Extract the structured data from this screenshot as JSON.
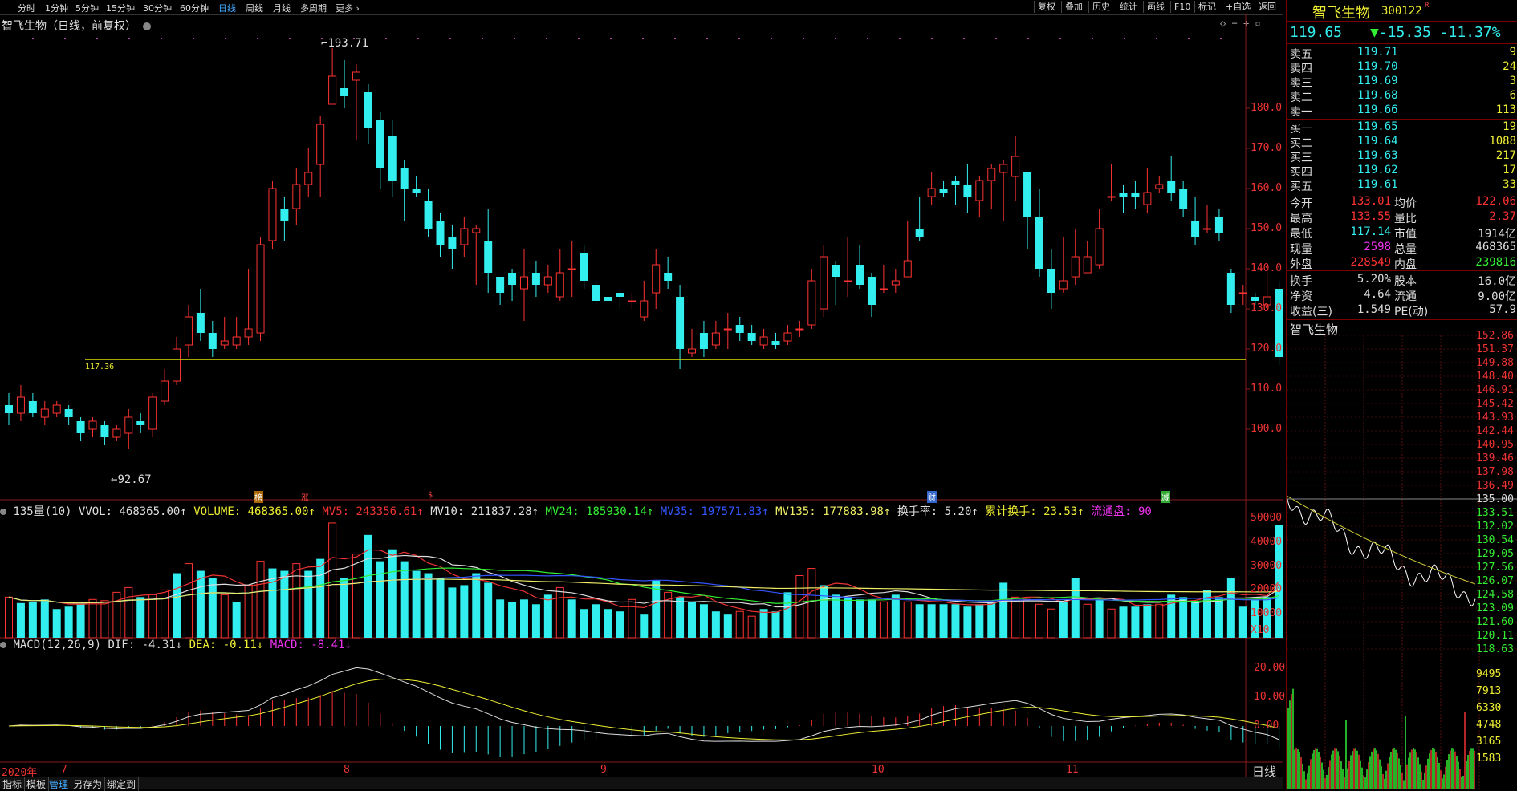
{
  "toolbar": {
    "periods": [
      {
        "label": "分时",
        "active": false
      },
      {
        "label": "1分钟",
        "active": false
      },
      {
        "label": "5分钟",
        "active": false
      },
      {
        "label": "15分钟",
        "active": false
      },
      {
        "label": "30分钟",
        "active": false
      },
      {
        "label": "60分钟",
        "active": false
      },
      {
        "label": "日线",
        "active": true
      },
      {
        "label": "周线",
        "active": false
      },
      {
        "label": "月线",
        "active": false
      },
      {
        "label": "多周期",
        "active": false
      },
      {
        "label": "更多",
        "active": false
      }
    ],
    "tools": [
      "复权",
      "叠加",
      "历史",
      "统计",
      "画线",
      "F10",
      "标记",
      "+自选",
      "返回"
    ]
  },
  "chart_title": "智飞生物（日线，前复权）",
  "annotations": {
    "high": "193.71",
    "low": "92.67",
    "support": "117.36"
  },
  "event_tags": [
    "榜",
    "涨",
    "$",
    "财",
    "减"
  ],
  "volume_header": {
    "name": "135量(10)",
    "items": [
      {
        "text": "VVOL: 468365.00↑",
        "color": "#dddddd"
      },
      {
        "text": "VOLUME: 468365.00↑",
        "color": "#eeee33"
      },
      {
        "text": "MV5: 243356.61↑",
        "color": "#ee3333"
      },
      {
        "text": "MV10: 211837.28↑",
        "color": "#dddddd"
      },
      {
        "text": "MV24: 185930.14↑",
        "color": "#33ee33"
      },
      {
        "text": "MV35: 197571.83↑",
        "color": "#3355ff"
      },
      {
        "text": "MV135: 177883.98↑",
        "color": "#eeee66"
      },
      {
        "text": "换手率: 5.20↑",
        "color": "#dddddd"
      },
      {
        "text": "累计换手: 23.53↑",
        "color": "#eeee33"
      },
      {
        "text": "流通盘: 90",
        "color": "#ee33ee"
      }
    ]
  },
  "macd_header": {
    "name": "MACD(12,26,9)",
    "items": [
      {
        "text": "DIF: -4.31↓",
        "color": "#dddddd"
      },
      {
        "text": "DEA: -0.11↓",
        "color": "#eeee33"
      },
      {
        "text": "MACD: -8.41↓",
        "color": "#ee33ee"
      }
    ]
  },
  "price_axis": [
    "180.0",
    "170.0",
    "160.0",
    "150.0",
    "140.0",
    "130.0",
    "120.0",
    "110.0",
    "100.0"
  ],
  "volume_axis": [
    "50000",
    "40000",
    "30000",
    "20000",
    "10000",
    "X10"
  ],
  "macd_axis": [
    "20.00",
    "10.00",
    "0.00"
  ],
  "x_axis": {
    "year": "2020年",
    "months": [
      "7",
      "8",
      "9",
      "10",
      "11"
    ],
    "period_label": "日线"
  },
  "bottom_tabs": [
    "指标",
    "模板",
    "管理",
    "另存为",
    "绑定到"
  ],
  "colors": {
    "up": "#ff3333",
    "down": "#33eeee",
    "ma5": "#ee3333",
    "ma10": "#dddddd",
    "ma24": "#33ee33",
    "ma35": "#3355ff",
    "ma135": "#eeee66"
  },
  "chart_data": {
    "type": "candlestick",
    "ylim": [
      87,
      197
    ],
    "candles": [
      [
        106,
        104,
        109,
        101
      ],
      [
        104,
        108,
        111,
        102
      ],
      [
        107,
        104,
        109,
        103
      ],
      [
        103,
        105,
        107,
        101
      ],
      [
        104,
        106,
        107,
        103
      ],
      [
        105,
        103,
        106,
        101
      ],
      [
        102,
        99,
        103,
        97
      ],
      [
        100,
        102,
        103,
        98
      ],
      [
        101,
        98,
        102,
        96
      ],
      [
        98,
        100,
        101,
        97
      ],
      [
        99,
        103,
        105,
        95
      ],
      [
        102,
        101,
        104,
        99
      ],
      [
        100,
        108,
        109,
        98
      ],
      [
        107,
        112,
        115,
        106
      ],
      [
        112,
        120,
        123,
        111
      ],
      [
        121,
        128,
        131,
        118
      ],
      [
        129,
        124,
        135,
        122
      ],
      [
        124,
        120,
        127,
        118
      ],
      [
        121,
        122,
        128,
        120
      ],
      [
        121,
        123,
        128,
        120
      ],
      [
        123,
        125,
        140,
        121
      ],
      [
        124,
        146,
        148,
        122
      ],
      [
        147,
        160,
        162,
        145
      ],
      [
        155,
        152,
        158,
        147
      ],
      [
        155,
        161,
        165,
        151
      ],
      [
        161,
        164,
        170,
        158
      ],
      [
        166,
        176,
        178,
        158
      ],
      [
        181,
        188,
        195,
        181
      ],
      [
        185,
        183,
        192,
        180
      ],
      [
        187,
        189,
        191,
        172
      ],
      [
        184,
        175,
        186,
        171
      ],
      [
        177,
        165,
        179,
        160
      ],
      [
        173,
        162,
        177,
        158
      ],
      [
        165,
        160,
        167,
        152
      ],
      [
        160,
        159,
        163,
        158
      ],
      [
        157,
        150,
        160,
        148
      ],
      [
        152,
        146,
        154,
        143
      ],
      [
        148,
        145,
        151,
        140
      ],
      [
        146,
        150,
        153,
        143
      ],
      [
        149,
        150,
        151,
        136
      ],
      [
        147,
        139,
        155,
        134
      ],
      [
        138,
        134,
        137,
        131
      ],
      [
        139,
        136,
        140,
        132
      ],
      [
        135,
        138,
        145,
        127
      ],
      [
        139,
        136,
        142,
        133
      ],
      [
        136,
        138,
        141,
        134
      ],
      [
        133,
        139,
        145,
        132
      ],
      [
        140,
        140,
        147,
        133
      ],
      [
        144,
        137,
        146,
        135
      ],
      [
        136,
        132,
        137,
        131
      ],
      [
        133,
        132,
        135,
        130
      ],
      [
        134,
        133,
        135,
        130
      ],
      [
        132,
        132,
        134,
        130
      ],
      [
        128,
        132,
        137,
        127
      ],
      [
        134,
        141,
        145,
        130
      ],
      [
        139,
        137,
        143,
        135
      ],
      [
        133,
        120,
        136,
        115
      ],
      [
        119,
        120,
        125,
        118
      ],
      [
        124,
        120,
        127,
        118
      ],
      [
        121,
        124,
        127,
        120
      ],
      [
        125,
        125,
        129,
        120
      ],
      [
        126,
        124,
        128,
        122
      ],
      [
        124,
        122,
        126,
        121
      ],
      [
        121,
        123,
        125,
        120
      ],
      [
        122,
        121,
        124,
        120
      ],
      [
        122,
        124,
        126,
        121
      ],
      [
        125,
        125,
        127,
        123
      ],
      [
        126,
        137,
        140,
        125
      ],
      [
        130,
        143,
        146,
        128
      ],
      [
        141,
        138,
        142,
        131
      ],
      [
        137,
        137,
        148,
        133
      ],
      [
        141,
        136,
        146,
        135
      ],
      [
        138,
        131,
        139,
        128
      ],
      [
        135,
        135,
        141,
        134
      ],
      [
        136,
        137,
        140,
        134
      ],
      [
        138,
        142,
        152,
        138
      ],
      [
        150,
        148,
        158,
        147
      ],
      [
        158,
        160,
        164,
        156
      ],
      [
        160,
        159,
        162,
        158
      ],
      [
        162,
        161,
        163,
        156
      ],
      [
        161,
        158,
        166,
        154
      ],
      [
        157,
        162,
        163,
        153
      ],
      [
        162,
        165,
        166,
        155
      ],
      [
        164,
        166,
        167,
        152
      ],
      [
        163,
        168,
        173,
        157
      ],
      [
        164,
        153,
        164,
        145
      ],
      [
        153,
        140,
        160,
        138
      ],
      [
        140,
        134,
        145,
        130
      ],
      [
        135,
        137,
        148,
        134
      ],
      [
        138,
        143,
        150,
        136
      ],
      [
        139,
        143,
        147,
        142
      ],
      [
        141,
        150,
        155,
        140
      ],
      [
        158,
        158,
        166,
        157
      ],
      [
        159,
        158,
        161,
        154
      ],
      [
        159,
        158,
        162,
        155
      ],
      [
        156,
        159,
        165,
        154
      ],
      [
        160,
        161,
        163,
        159
      ],
      [
        162,
        159,
        168,
        157
      ],
      [
        160,
        155,
        162,
        153
      ],
      [
        152,
        148,
        158,
        146
      ],
      [
        150,
        150,
        156,
        149
      ],
      [
        153,
        149,
        155,
        147
      ],
      [
        139,
        131,
        140,
        129
      ],
      [
        134,
        134,
        136,
        131
      ],
      [
        133,
        132,
        134,
        131
      ],
      [
        131,
        133,
        140,
        130
      ],
      [
        135,
        118,
        137,
        116
      ]
    ],
    "volume": [
      [
        17000,
        1
      ],
      [
        14500,
        0
      ],
      [
        15000,
        0
      ],
      [
        16000,
        0
      ],
      [
        12000,
        0
      ],
      [
        13000,
        0
      ],
      [
        14000,
        0
      ],
      [
        16000,
        1
      ],
      [
        15500,
        1
      ],
      [
        19000,
        1
      ],
      [
        21000,
        1
      ],
      [
        17000,
        0
      ],
      [
        18000,
        1
      ],
      [
        20000,
        1
      ],
      [
        27000,
        0
      ],
      [
        31000,
        1
      ],
      [
        28000,
        0
      ],
      [
        25000,
        0
      ],
      [
        18000,
        1
      ],
      [
        15000,
        0
      ],
      [
        22000,
        1
      ],
      [
        32000,
        1
      ],
      [
        29000,
        0
      ],
      [
        28000,
        0
      ],
      [
        31000,
        1
      ],
      [
        28000,
        0
      ],
      [
        33000,
        0
      ],
      [
        48000,
        1
      ],
      [
        25000,
        0
      ],
      [
        35000,
        1
      ],
      [
        43000,
        0
      ],
      [
        32000,
        0
      ],
      [
        37000,
        0
      ],
      [
        32000,
        0
      ],
      [
        28000,
        0
      ],
      [
        27000,
        0
      ],
      [
        25000,
        0
      ],
      [
        21000,
        0
      ],
      [
        22000,
        0
      ],
      [
        27000,
        0
      ],
      [
        23000,
        0
      ],
      [
        16000,
        0
      ],
      [
        15000,
        0
      ],
      [
        16000,
        0
      ],
      [
        14000,
        0
      ],
      [
        18000,
        0
      ],
      [
        21000,
        1
      ],
      [
        16000,
        0
      ],
      [
        12000,
        0
      ],
      [
        14000,
        0
      ],
      [
        12000,
        0
      ],
      [
        11000,
        0
      ],
      [
        16000,
        1
      ],
      [
        10000,
        0
      ],
      [
        24000,
        0
      ],
      [
        19000,
        1
      ],
      [
        17000,
        0
      ],
      [
        15000,
        0
      ],
      [
        14000,
        0
      ],
      [
        11000,
        0
      ],
      [
        10000,
        0
      ],
      [
        11000,
        1
      ],
      [
        9000,
        1
      ],
      [
        12000,
        0
      ],
      [
        11000,
        0
      ],
      [
        19000,
        0
      ],
      [
        26000,
        1
      ],
      [
        29000,
        1
      ],
      [
        22000,
        0
      ],
      [
        18000,
        0
      ],
      [
        17000,
        0
      ],
      [
        16000,
        0
      ],
      [
        16000,
        0
      ],
      [
        15000,
        1
      ],
      [
        18000,
        0
      ],
      [
        15000,
        1
      ],
      [
        14000,
        0
      ],
      [
        14000,
        0
      ],
      [
        14000,
        0
      ],
      [
        14000,
        0
      ],
      [
        13000,
        0
      ],
      [
        14000,
        0
      ],
      [
        15000,
        0
      ],
      [
        23000,
        0
      ],
      [
        17000,
        1
      ],
      [
        16000,
        1
      ],
      [
        14000,
        1
      ],
      [
        12000,
        1
      ],
      [
        15000,
        0
      ],
      [
        25000,
        0
      ],
      [
        14000,
        1
      ],
      [
        16000,
        0
      ],
      [
        12000,
        1
      ],
      [
        13000,
        0
      ],
      [
        13000,
        0
      ],
      [
        14000,
        0
      ],
      [
        14000,
        1
      ],
      [
        18000,
        0
      ],
      [
        17000,
        0
      ],
      [
        15000,
        0
      ],
      [
        20000,
        0
      ],
      [
        17000,
        0
      ],
      [
        25000,
        0
      ],
      [
        13000,
        0
      ],
      [
        16000,
        0
      ],
      [
        17000,
        0
      ],
      [
        47000,
        0
      ]
    ],
    "volume_ylim": [
      0,
      52000
    ]
  },
  "quote": {
    "name": "智飞生物",
    "code": "300122",
    "badge": "R",
    "price": "119.65",
    "arrow": "▼",
    "change": "-15.35",
    "pct": "-11.37%",
    "asks": [
      {
        "label": "卖五",
        "price": "119.71",
        "vol": "9"
      },
      {
        "label": "卖四",
        "price": "119.70",
        "vol": "24"
      },
      {
        "label": "卖三",
        "price": "119.69",
        "vol": "3"
      },
      {
        "label": "卖二",
        "price": "119.68",
        "vol": "6"
      },
      {
        "label": "卖一",
        "price": "119.66",
        "vol": "113"
      }
    ],
    "bids": [
      {
        "label": "买一",
        "price": "119.65",
        "vol": "19"
      },
      {
        "label": "买二",
        "price": "119.64",
        "vol": "1088"
      },
      {
        "label": "买三",
        "price": "119.63",
        "vol": "217"
      },
      {
        "label": "买四",
        "price": "119.62",
        "vol": "17"
      },
      {
        "label": "买五",
        "price": "119.61",
        "vol": "33"
      }
    ],
    "stats": [
      {
        "l1": "今开",
        "v1": "133.01",
        "l2": "均价",
        "v2": "122.06",
        "c1": "#ff3333",
        "c2": "#ff3333"
      },
      {
        "l1": "最高",
        "v1": "133.55",
        "l2": "量比",
        "v2": "2.37",
        "c1": "#ff3333",
        "c2": "#ff3333"
      },
      {
        "l1": "最低",
        "v1": "117.14",
        "l2": "市值",
        "v2": "1914亿",
        "c1": "#33eeee",
        "c2": "#dddddd"
      },
      {
        "l1": "现量",
        "v1": "2598",
        "l2": "总量",
        "v2": "468365",
        "c1": "#ee33ee",
        "c2": "#dddddd"
      },
      {
        "l1": "外盘",
        "v1": "228549",
        "l2": "内盘",
        "v2": "239816",
        "c1": "#ff3333",
        "c2": "#33ee33"
      }
    ],
    "fundamentals": [
      {
        "l1": "换手",
        "v1": "5.20%",
        "l2": "股本",
        "v2": "16.0亿"
      },
      {
        "l1": "净资",
        "v1": "4.64",
        "l2": "流通",
        "v2": "9.00亿"
      },
      {
        "l1": "收益(三)",
        "v1": "1.549",
        "l2": "PE(动)",
        "v2": "57.9"
      }
    ],
    "mini_title": "智飞生物",
    "mini_axis": [
      "152.86",
      "151.37",
      "149.88",
      "148.40",
      "146.91",
      "145.42",
      "143.93",
      "142.44",
      "140.95",
      "139.46",
      "137.98",
      "136.49",
      "135.00",
      "133.51",
      "132.02",
      "130.54",
      "129.05",
      "127.56",
      "126.07",
      "124.58",
      "123.09",
      "121.60",
      "120.11",
      "118.63"
    ],
    "mini_vol_axis": [
      "9495",
      "7913",
      "6330",
      "4748",
      "3165",
      "1583"
    ]
  }
}
